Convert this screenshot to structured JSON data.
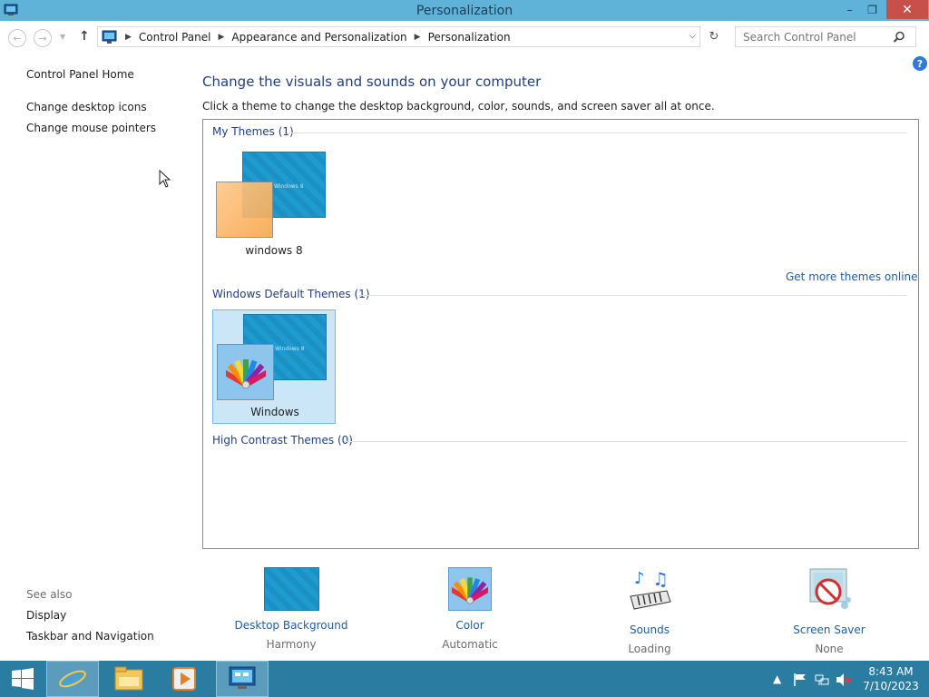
{
  "window": {
    "title": "Personalization",
    "controls": {
      "minimize": "–",
      "restore": "❐",
      "close": "✕"
    }
  },
  "address": {
    "breadcrumbs": [
      "Control Panel",
      "Appearance and Personalization",
      "Personalization"
    ],
    "search_placeholder": "Search Control Panel"
  },
  "sidebar": {
    "links": [
      "Control Panel Home",
      "Change desktop icons",
      "Change mouse pointers"
    ],
    "see_also_label": "See also",
    "see_also_links": [
      "Display",
      "Taskbar and Navigation"
    ]
  },
  "main": {
    "heading": "Change the visuals and sounds on your computer",
    "subheading": "Click a theme to change the desktop background, color, sounds, and screen saver all at once.",
    "groups": {
      "my_themes": "My Themes (1)",
      "default_themes": "Windows Default Themes (1)",
      "high_contrast": "High Contrast Themes (0)"
    },
    "themes": {
      "custom": "windows 8",
      "default": "Windows"
    },
    "get_more": "Get more themes online",
    "thumb_watermark": "Windows 8"
  },
  "bottom": [
    {
      "title": "Desktop Background",
      "subtitle": "Harmony",
      "icon": "desktop-background-icon"
    },
    {
      "title": "Color",
      "subtitle": "Automatic",
      "icon": "color-palette-icon"
    },
    {
      "title": "Sounds",
      "subtitle": "Loading",
      "icon": "sounds-icon"
    },
    {
      "title": "Screen Saver",
      "subtitle": "None",
      "icon": "screen-saver-icon"
    }
  ],
  "taskbar": {
    "time": "8:43 AM",
    "date": "7/10/2023",
    "tray_arrow": "▲"
  },
  "colors": {
    "titlebar": "#5fb3d9",
    "close_button": "#c7504a",
    "link": "#1e5ea8",
    "heading": "#1e3f8c",
    "taskbar": "#2a7ca0",
    "selected_theme": "#cbe6f7"
  }
}
